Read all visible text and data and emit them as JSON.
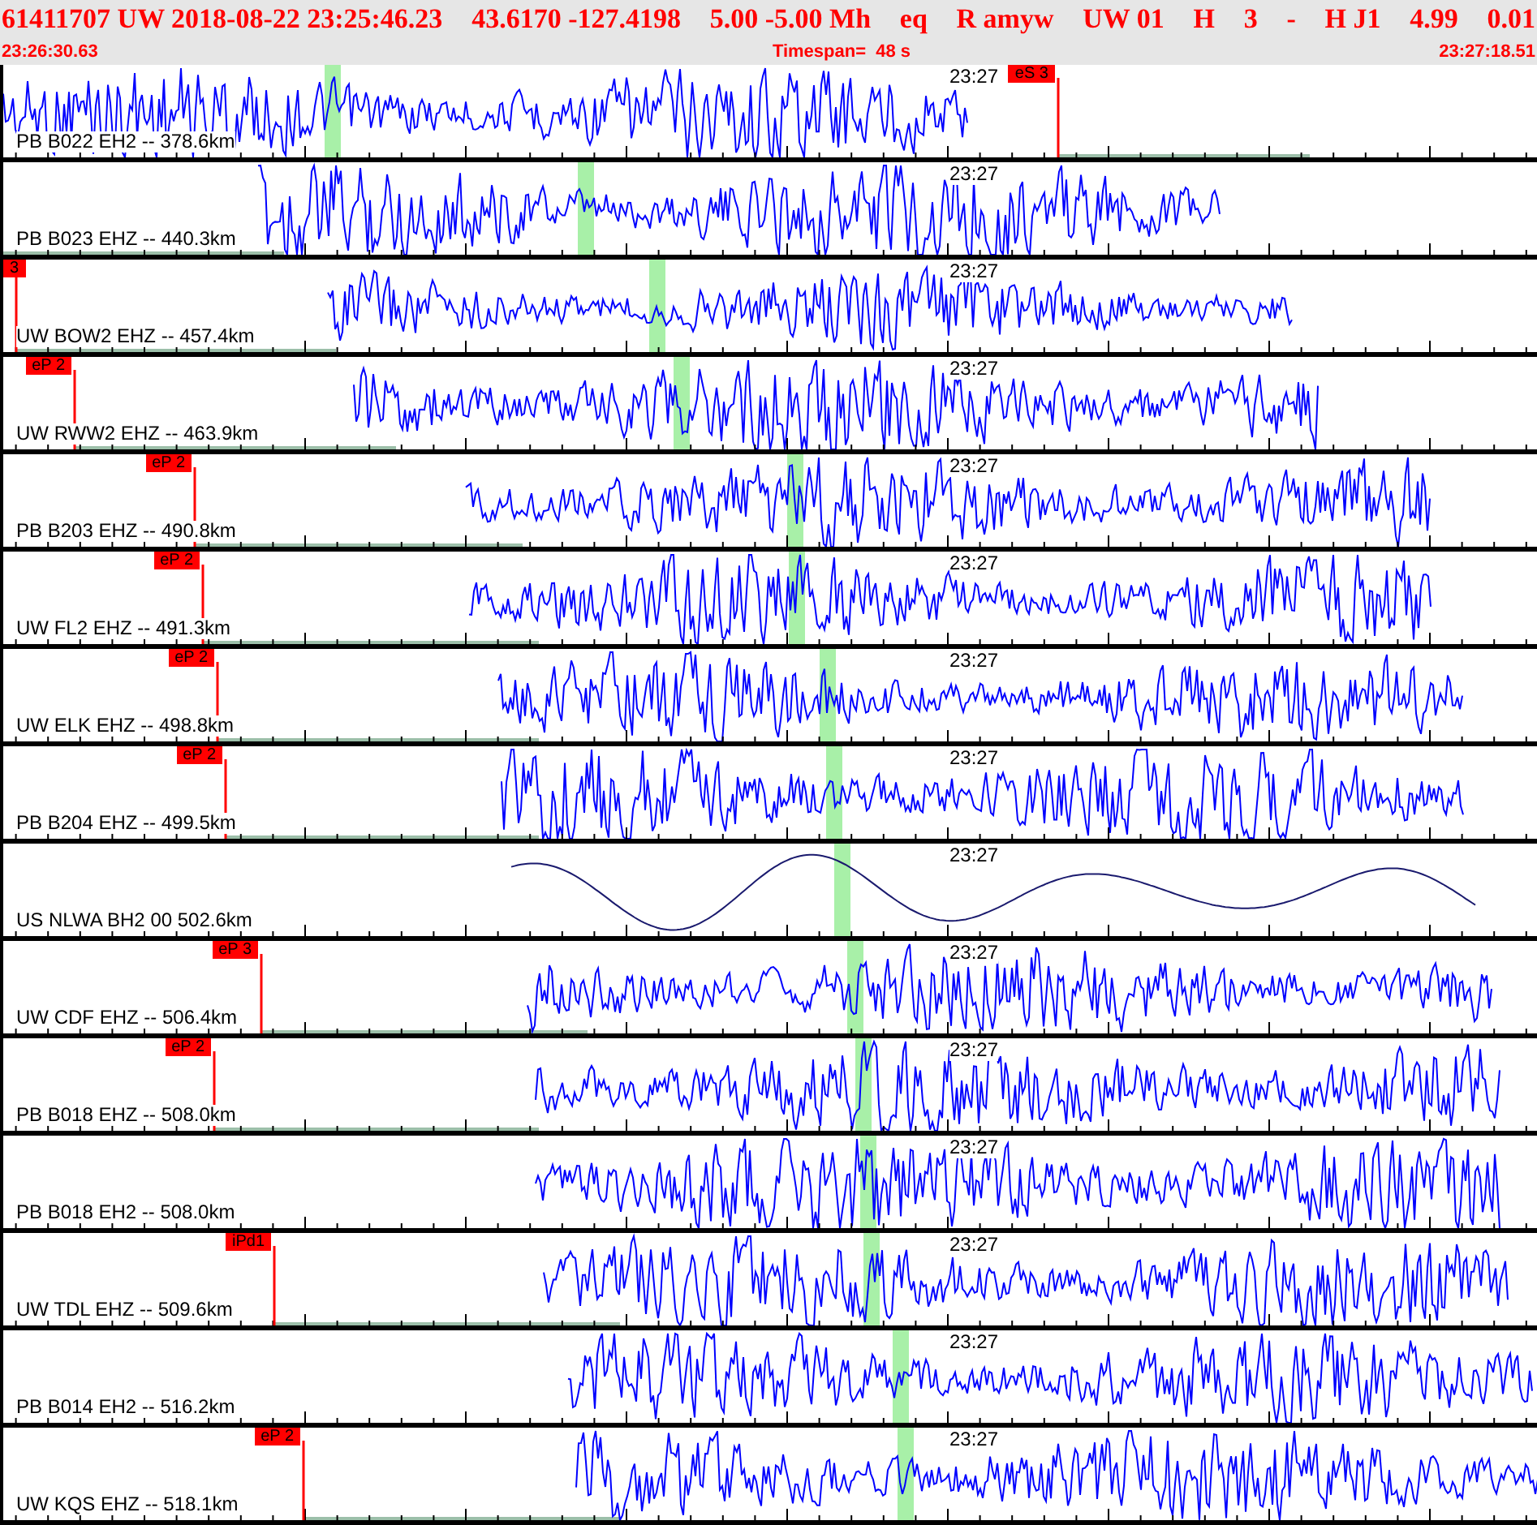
{
  "header": {
    "fields": [
      "61411707 UW 2018-08-22 23:25:46.23",
      "43.6170 -127.4198",
      "5.00 -5.00 Mh",
      "eq",
      "R amyw",
      "UW 01",
      "H",
      "3",
      "-",
      "H J1",
      "4.99",
      "0.01"
    ],
    "start": "23:26:30.63",
    "timespan": "Timespan=  48 s",
    "end": "23:27:18.51"
  },
  "traces": [
    {
      "label": "PB B022 EH2 -- 378.6km",
      "time": "23:27",
      "pick": "eS 3",
      "kind": "noisy"
    },
    {
      "label": "PB B023 EHZ -- 440.3km",
      "time": "23:27",
      "kind": "noisy"
    },
    {
      "label": "UW BOW2 EHZ -- 457.4km",
      "time": "23:27",
      "pick": "3",
      "kind": "noisy"
    },
    {
      "label": "UW RWW2 EHZ -- 463.9km",
      "time": "23:27",
      "pick": "eP 2",
      "kind": "noisy"
    },
    {
      "label": "PB B203 EHZ -- 490.8km",
      "time": "23:27",
      "pick": "eP 2",
      "kind": "noisy"
    },
    {
      "label": "UW FL2 EHZ -- 491.3km",
      "time": "23:27",
      "pick": "eP 2",
      "kind": "noisy"
    },
    {
      "label": "UW ELK EHZ -- 498.8km",
      "time": "23:27",
      "pick": "eP 2",
      "kind": "noisy"
    },
    {
      "label": "PB B204 EHZ -- 499.5km",
      "time": "23:27",
      "pick": "eP 2",
      "kind": "noisy"
    },
    {
      "label": "US NLWA BH2 00 502.6km",
      "time": "23:27",
      "kind": "smooth"
    },
    {
      "label": "UW CDF EHZ -- 506.4km",
      "time": "23:27",
      "pick": "eP 3",
      "kind": "noisy"
    },
    {
      "label": "PB B018 EHZ -- 508.0km",
      "time": "23:27",
      "pick": "eP 2",
      "kind": "noisy"
    },
    {
      "label": "PB B018 EH2 -- 508.0km",
      "time": "23:27",
      "kind": "noisy"
    },
    {
      "label": "UW TDL EHZ -- 509.6km",
      "time": "23:27",
      "pick": "iPd1",
      "kind": "noisy"
    },
    {
      "label": "PB B014 EH2 -- 516.2km",
      "time": "23:27",
      "kind": "noisy"
    },
    {
      "label": "UW KQS EHZ -- 518.1km",
      "time": "23:27",
      "pick": "eP 2",
      "kind": "noisy"
    }
  ]
}
